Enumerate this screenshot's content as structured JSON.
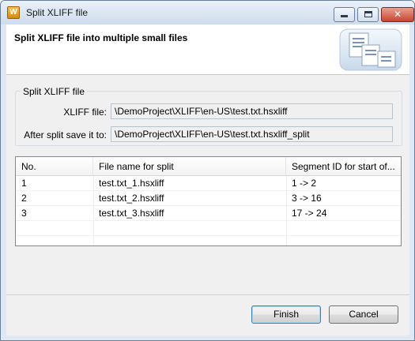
{
  "window": {
    "title": "Split XLIFF file",
    "app_icon": "app-icon",
    "controls": {
      "minimize": "minimize-icon",
      "maximize": "maximize-icon",
      "close_label": "✕"
    }
  },
  "header": {
    "title": "Split XLIFF file into multiple small files",
    "icon": "wizard-document-icon"
  },
  "group": {
    "legend": "Split XLIFF file",
    "xliff_label": "XLIFF file:",
    "xliff_value": "\\DemoProject\\XLIFF\\en-US\\test.txt.hsxliff",
    "save_label": "After split save it to:",
    "save_value": "\\DemoProject\\XLIFF\\en-US\\test.txt.hsxliff_split"
  },
  "table": {
    "columns": [
      "No.",
      "File name for split",
      "Segment ID for start of..."
    ],
    "rows": [
      [
        "1",
        "test.txt_1.hsxliff",
        "1 -> 2"
      ],
      [
        "2",
        "test.txt_2.hsxliff",
        "3 -> 16"
      ],
      [
        "3",
        "test.txt_3.hsxliff",
        "17 -> 24"
      ]
    ]
  },
  "footer": {
    "finish_label": "Finish",
    "cancel_label": "Cancel"
  },
  "colors": {
    "titlebar": "#dfe9f5",
    "close_button": "#c6452f",
    "dialog_bg": "#f0f0f0",
    "default_button_border": "#3c7fb1"
  }
}
